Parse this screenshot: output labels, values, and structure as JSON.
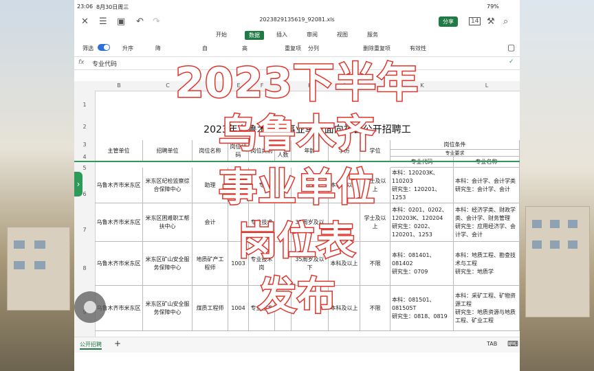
{
  "status": {
    "time": "23:06",
    "date": "8月30日周三",
    "battery": "79%"
  },
  "toolbar": {
    "filename": "2023829135619_92081.xls",
    "share_label": "分享",
    "count": "14"
  },
  "tabs": [
    "开始",
    "数据",
    "插入",
    "审阅",
    "视图",
    "服务"
  ],
  "active_tab": "数据",
  "ribbon": {
    "filter_label": "筛选",
    "sort_asc": "升序",
    "sort_desc": "降",
    "items": [
      "自",
      "高",
      "重复项",
      "分列",
      "删除重复项",
      "有效性"
    ]
  },
  "formula_bar": {
    "fx": "fx",
    "value": "专业代码"
  },
  "columns": [
    "B",
    "C",
    "D",
    "E",
    "F",
    "G",
    "H",
    "I",
    "J",
    "K",
    "L"
  ],
  "rows": [
    "1",
    "2",
    "3",
    "4",
    "5",
    "6",
    "7",
    "8",
    "9"
  ],
  "sheet_title": "2023年乌鲁木齐市事业单位面向社会公开招聘工",
  "headers": {
    "main_unit": "主管单位",
    "recruit_unit": "招聘单位",
    "post_name": "岗位名称",
    "post_code": "岗位代码",
    "post_type": "岗位类别",
    "recruit_num": "招聘人数",
    "age": "年龄",
    "edu": "学历",
    "degree": "学位",
    "cond": "岗位条件",
    "major_req": "专业要求",
    "major_code": "专业代码",
    "major_name": "专业名称"
  },
  "table_rows": [
    {
      "main": "乌鲁木齐市米东区",
      "unit": "米东区纪检监察综合保障中心",
      "post": "助理",
      "code": "",
      "type": "专",
      "num": "",
      "age": "35",
      "edu": "本科及以上",
      "degree": "学士及以上",
      "major_code": "本科：120203K、110203\n研究生：120201、1253",
      "major_name": "本科：会计学、会计学类\n研究生：会计学、会计"
    },
    {
      "main": "乌鲁木齐市米东区",
      "unit": "米东区困难职工帮扶中心",
      "post": "会计",
      "code": "",
      "type": "专业技术",
      "num": "",
      "age": "35周岁及以",
      "edu": "",
      "degree": "学士及以上",
      "major_code": "本科：0201、0202、120203K、120204\n研究生：0202、120201、1253",
      "major_name": "本科：经济学类、财政学类、会计学、财务管理\n研究生：应用经济学、会计学、会计"
    },
    {
      "main": "乌鲁木齐市米东区",
      "unit": "米东区矿山安全服务保障中心",
      "post": "地质矿产工程师",
      "code": "1003",
      "type": "专业技术岗",
      "num": "",
      "age": "35周岁及以下",
      "edu": "本科及以上",
      "degree": "不限",
      "major_code": "本科：081401、081402\n研究生：0709",
      "major_name": "本科：地质工程、勘查技术与工程\n研究生：地质学"
    },
    {
      "main": "乌鲁木齐市米东区",
      "unit": "米东区矿山安全服务保障中心",
      "post": "煤质工程师",
      "code": "1004",
      "type": "专业技术",
      "num": "",
      "age": "",
      "edu": "本科及以上",
      "degree": "不限",
      "major_code": "本科：081501、081505T\n研究生：0818、0819",
      "major_name": "本科：采矿工程、矿物资源工程\n研究生：地质资源与地质工程、矿业工程"
    }
  ],
  "bottom": {
    "sheet_tab": "公开招聘",
    "add": "+",
    "tab_key": "TAB"
  },
  "overlay": [
    "2023下半年",
    "乌鲁木齐",
    "事业单位",
    "岗位表",
    "发布"
  ],
  "colors": {
    "overlay_stroke": "#e0342a",
    "accent": "#1f7a45"
  }
}
